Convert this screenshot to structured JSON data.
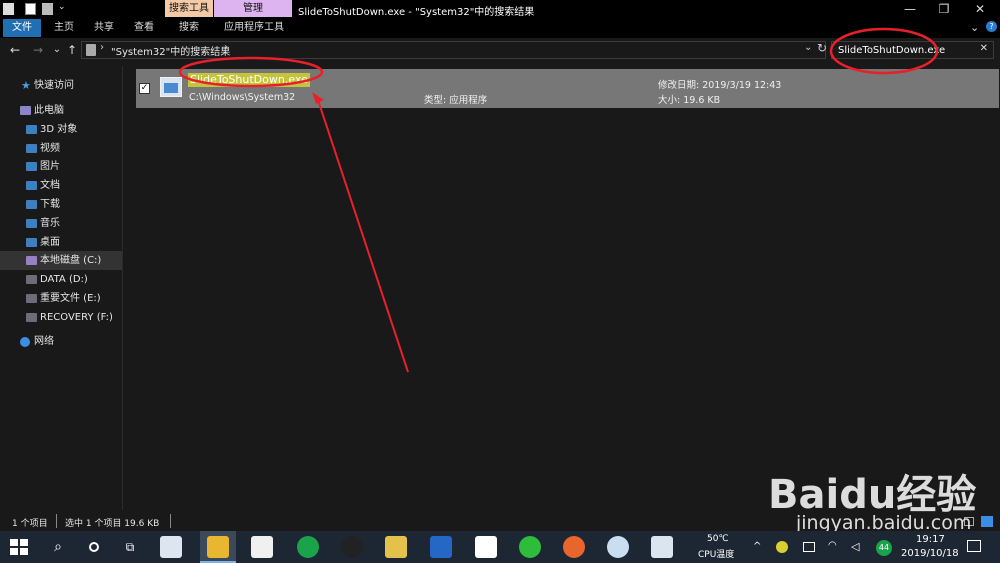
{
  "window": {
    "title": "SlideToShutDown.exe - \"System32\"中的搜索结果",
    "context_tabs": [
      "搜索工具",
      "管理"
    ],
    "controls": {
      "minimize": "—",
      "restore": "❐",
      "close": "✕"
    }
  },
  "ribbon": {
    "tabs": [
      "文件",
      "主页",
      "共享",
      "查看",
      "搜索",
      "应用程序工具"
    ],
    "collapse": "⌄",
    "help": "?"
  },
  "address": {
    "back": "←",
    "forward": "→",
    "history": "⌄",
    "up": "↑",
    "path": "\"System32\"中的搜索结果",
    "sep1": "›",
    "sep2": "›",
    "dropdown": "⌄",
    "refresh": "↻"
  },
  "search": {
    "value": "SlideToShutDown.exe",
    "clear": "✕"
  },
  "sidebar": {
    "quick_access": "快速访问",
    "this_pc": "此电脑",
    "items": [
      "3D 对象",
      "视频",
      "图片",
      "文档",
      "下载",
      "音乐",
      "桌面",
      "本地磁盘 (C:)",
      "DATA (D:)",
      "重要文件 (E:)",
      "RECOVERY (F:)"
    ],
    "network": "网络"
  },
  "result": {
    "checked": "✓",
    "name": "SlideToShutDown.exe",
    "path": "C:\\Windows\\System32",
    "type": "类型: 应用程序",
    "modified": "修改日期: 2019/3/19 12:43",
    "size": "大小: 19.6 KB"
  },
  "status": {
    "count": "1 个项目",
    "selection": "选中 1 个项目  19.6 KB"
  },
  "taskbar": {
    "cpu_temp": "50℃",
    "cpu_label": "CPU温度",
    "badge": "44",
    "time": "19:17",
    "date": "2019/10/18"
  },
  "watermark": {
    "brand": "Baidu经验",
    "url": "jingyan.baidu.com"
  },
  "colors": {
    "accent": "#1f6fb2",
    "annotation": "#e8202a",
    "selection": "#777777",
    "highlight": "#c4c43a"
  }
}
